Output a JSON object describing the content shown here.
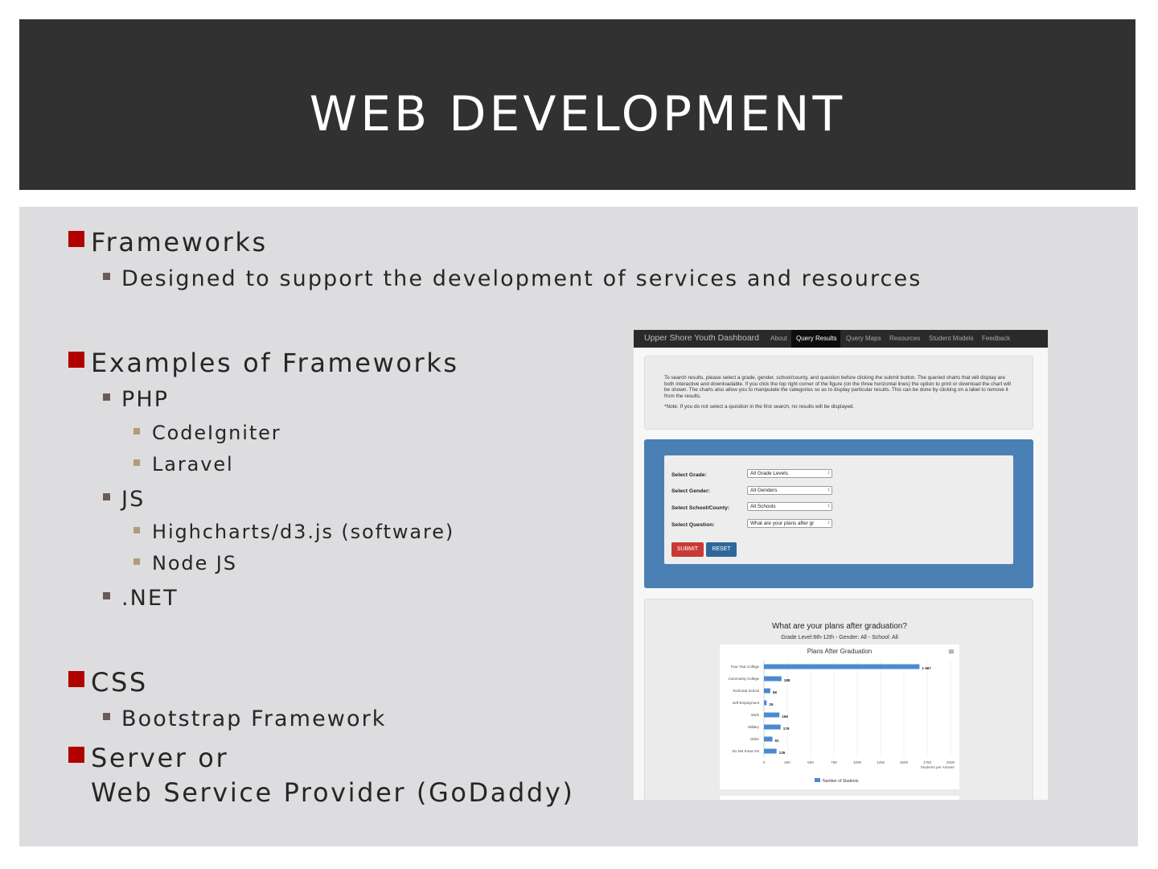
{
  "slide": {
    "title": "WEB DEVELOPMENT"
  },
  "bullets": {
    "frameworks": "Frameworks",
    "frameworks_desc": "Designed to support the development of services and resources",
    "examples": "Examples of Frameworks",
    "php": "PHP",
    "codeigniter": "CodeIgniter",
    "laravel": "Laravel",
    "js": "JS",
    "highcharts": "Highcharts/d3.js (software)",
    "nodejs": "Node JS",
    "dotnet": ".NET",
    "css": "CSS",
    "bootstrap": "Bootstrap Framework",
    "server_line1": "Server or",
    "server_line2": "Web Service Provider (GoDaddy)"
  },
  "screenshot": {
    "nav": {
      "brand": "Upper Shore Youth Dashboard",
      "items": [
        "About",
        "Query Results",
        "Query Maps",
        "Resources",
        "Student Models",
        "Feedback"
      ],
      "active": "Query Results"
    },
    "info_text": "To search results, please select a grade, gender, school/county, and question before clicking the submit button. The queried charts that will display are both interactive and downloadable. If you click the top right corner of the figure (on the three horizontal lines) the option to print or download the chart will be shown. The charts also allow you to manipulate the categories so as to display particular results. This can be done by clicking on a label to remove it from the results.",
    "info_note": "*Note: If you do not select a question in the first search, no results will be displayed.",
    "form": {
      "grade_label": "Select Grade:",
      "grade_value": "All Grade Levels",
      "gender_label": "Select Gender:",
      "gender_value": "All Genders",
      "school_label": "Select School/County:",
      "school_value": "All Schools",
      "question_label": "Select Question:",
      "question_value": "What are your plans after gr",
      "submit": "SUBMIT",
      "reset": "RESET"
    },
    "chart_heading": "What are your plans after graduation?",
    "chart_subheading": "Grade Level:6th-12th - Gender: All - School: All"
  },
  "chart_data": {
    "type": "bar",
    "orientation": "horizontal",
    "title": "Plans After Graduation",
    "categories": [
      "Four Year College",
      "Community College",
      "Technical School",
      "Self-Employment",
      "Work",
      "Military",
      "Other",
      "Do Not Know Yet"
    ],
    "series": [
      {
        "name": "Number of Students",
        "values": [
          1667,
          188,
          68,
          29,
          166,
          179,
          91,
          135
        ]
      }
    ],
    "value_labels": [
      "1 667",
      "188",
      "68",
      "29",
      "166",
      "179",
      "91",
      "135"
    ],
    "x_ticks": [
      0,
      250,
      500,
      750,
      1000,
      1250,
      1500,
      1750,
      2000
    ],
    "xlim": [
      0,
      2000
    ],
    "xlabel": "Students per Answer",
    "ylabel": "",
    "grid": true,
    "legend": "bottom-center",
    "menu_icon": "hamburger-icon",
    "bar_color": "#4a8ad0"
  }
}
